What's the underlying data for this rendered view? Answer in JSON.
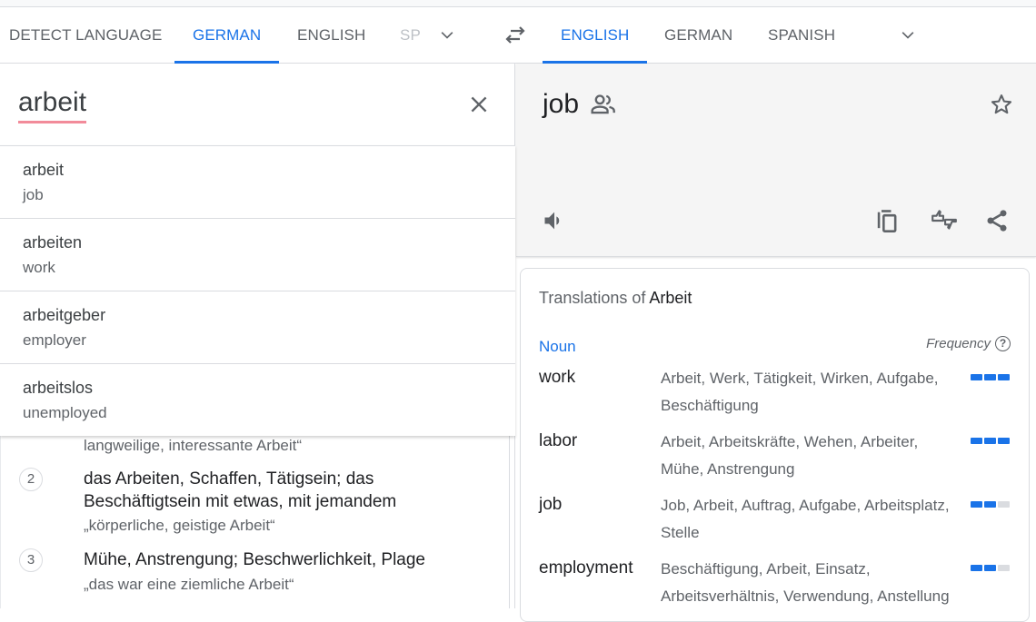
{
  "source_langs": {
    "tabs": [
      {
        "label": "Detect language",
        "active": false
      },
      {
        "label": "German",
        "active": true
      },
      {
        "label": "English",
        "active": false
      },
      {
        "label": "Spanish",
        "active": false,
        "truncated": "SP"
      }
    ],
    "more_icon": "chevron-down-icon"
  },
  "swap_icon": "swap-arrows-icon",
  "target_langs": {
    "tabs": [
      {
        "label": "English",
        "active": true
      },
      {
        "label": "German",
        "active": false
      },
      {
        "label": "Spanish",
        "active": false
      }
    ],
    "more_icon": "chevron-down-icon"
  },
  "source": {
    "text": "arbeit",
    "clear_icon": "close-icon"
  },
  "suggestions": [
    {
      "source": "arbeit",
      "translation": "job"
    },
    {
      "source": "arbeiten",
      "translation": "work"
    },
    {
      "source": "arbeitgeber",
      "translation": "employer"
    },
    {
      "source": "arbeitslos",
      "translation": "unemployed"
    }
  ],
  "definitions": {
    "partial_example": "langweilige, interessante Arbeit“",
    "items": [
      {
        "number": "2",
        "text": "das Arbeiten, Schaffen, Tätigsein; das Beschäftigtsein mit etwas, mit jemandem",
        "example": "„körperliche, geistige Arbeit“"
      },
      {
        "number": "3",
        "text": "Mühe, Anstrengung; Beschwerlichkeit, Plage",
        "example": "„das war eine ziemliche Arbeit“"
      }
    ]
  },
  "target": {
    "text": "job",
    "icons": {
      "community": "community-people-icon",
      "star": "star-icon",
      "speaker": "speaker-icon",
      "copy": "copy-icon",
      "feedback": "thumbs-feedback-icon",
      "share": "share-icon"
    }
  },
  "translations": {
    "title_prefix": "Translations of ",
    "title_word": "Arbeit",
    "pos": "Noun",
    "frequency_label": "Frequency",
    "rows": [
      {
        "term": "work",
        "back": [
          "Arbeit",
          "Werk",
          "Tätigkeit",
          "Wirken",
          "Aufgabe",
          "Beschäftigung"
        ],
        "back_text": "Arbeit, Werk, Tätigkeit, Wirken, Aufgabe, Beschäftigung",
        "frequency": 3,
        "frequency_max": 3
      },
      {
        "term": "labor",
        "back": [
          "Arbeit",
          "Arbeitskräfte",
          "Wehen",
          "Arbeiter",
          "Mühe",
          "Anstrengung"
        ],
        "back_text": "Arbeit, Arbeitskräfte, Wehen, Arbeiter, Mühe, Anstrengung",
        "frequency": 3,
        "frequency_max": 3
      },
      {
        "term": "job",
        "back": [
          "Job",
          "Arbeit",
          "Auftrag",
          "Aufgabe",
          "Arbeitsplatz",
          "Stelle"
        ],
        "back_text": "Job, Arbeit, Auftrag, Aufgabe, Arbeitsplatz, Stelle",
        "frequency": 2,
        "frequency_max": 3
      },
      {
        "term": "employment",
        "back": [
          "Beschäftigung",
          "Arbeit",
          "Einsatz",
          "Arbeitsverhältnis",
          "Verwendung",
          "Anstellung"
        ],
        "back_text": "Beschäftigung, Arbeit, Einsatz, Arbeitsverhältnis, Verwendung, Anstellung",
        "frequency": 2,
        "frequency_max": 3
      }
    ]
  },
  "colors": {
    "accent": "#1a73e8",
    "muted": "#5f6368",
    "spell_underline": "#f28b9a",
    "freq_off": "#dadce0"
  }
}
